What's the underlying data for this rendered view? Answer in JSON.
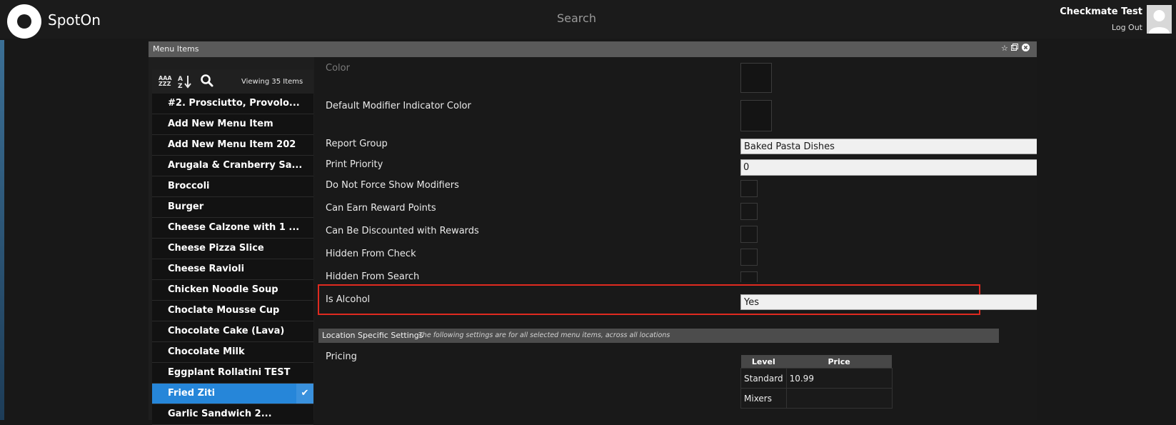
{
  "header": {
    "brand": "SpotOn",
    "search_label": "Search",
    "user_name": "Checkmate Test",
    "logout_label": "Log Out"
  },
  "window": {
    "title": "Menu Items"
  },
  "list": {
    "sort_alpha_top": "AAA",
    "sort_alpha_bottom": "ZZZ",
    "viewing_label": "Viewing 35 Items",
    "items": [
      "#2. Prosciutto, Provolo...",
      "Add New Menu Item",
      "Add New Menu Item 202",
      "Arugala & Cranberry Sa...",
      "Broccoli",
      "Burger",
      "Cheese Calzone with 1 ...",
      "Cheese Pizza Slice",
      "Cheese Ravioli",
      "Chicken Noodle Soup",
      "Choclate Mousse Cup",
      "Chocolate Cake (Lava)",
      "Chocolate Milk",
      "Eggplant Rollatini TEST",
      "Fried Ziti",
      "Garlic Sandwich 2..."
    ],
    "selected_item": "Fried Ziti"
  },
  "form": {
    "color_label": "Color",
    "default_modifier_color_label": "Default Modifier Indicator Color",
    "report_group_label": "Report Group",
    "report_group_value": "Baked Pasta Dishes",
    "print_priority_label": "Print Priority",
    "print_priority_value": "0",
    "do_not_force_label": "Do Not Force Show Modifiers",
    "reward_points_label": "Can Earn Reward Points",
    "discounted_label": "Can Be Discounted with Rewards",
    "hidden_check_label": "Hidden From Check",
    "hidden_search_label": "Hidden From Search",
    "is_alcohol_label": "Is Alcohol",
    "is_alcohol_value": "Yes"
  },
  "location_settings": {
    "title": "Location Specific Settings",
    "description": "The following settings are for all selected menu items, across all locations",
    "pricing_label": "Pricing",
    "columns": [
      "Level",
      "Price"
    ],
    "rows": [
      {
        "level": "Standard",
        "price": "10.99"
      },
      {
        "level": "Mixers",
        "price": ""
      }
    ]
  },
  "colors": {
    "accent": "#2686d9",
    "highlight_border": "#e02a20",
    "background": "#181818"
  }
}
